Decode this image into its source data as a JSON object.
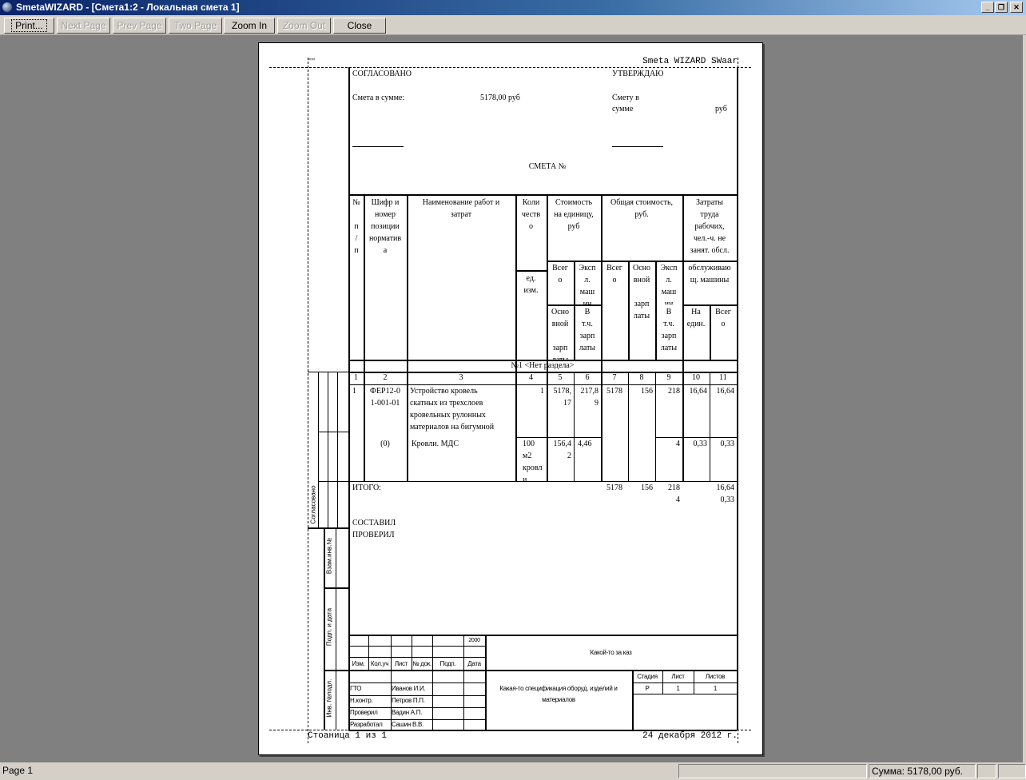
{
  "window": {
    "title": "SmetaWIZARD - [Смета1:2 - Локальная смета 1]",
    "controls": [
      "_",
      "❐",
      "✕"
    ]
  },
  "toolbar": [
    {
      "label": "Print...",
      "enabled": true
    },
    {
      "label": "Next Page",
      "enabled": false
    },
    {
      "label": "Prev Page",
      "enabled": false
    },
    {
      "label": "Two Page",
      "enabled": false
    },
    {
      "label": "Zoom In",
      "enabled": true
    },
    {
      "label": "Zoom Out",
      "enabled": false
    },
    {
      "label": "Close",
      "enabled": true
    }
  ],
  "page": {
    "top_left": "\"\"",
    "top_right": "Smeta WIZARD SWaar",
    "agreed": "СОГЛАСОВАНО",
    "approve": "УТВЕРЖДАЮ",
    "sum_label": "Смета в сумме:",
    "sum_value": "5178,00 руб",
    "approve_sum_1": "Смету в",
    "approve_sum_2": "сумме",
    "approve_sum_cur": "руб",
    "doc_title": "СМЕТА №",
    "headers": {
      "num": "№\n\nп\n/\nп",
      "code": "Шифр и\nномер\nпозиции\nнорматив\nа",
      "name": "Наименование работ и\nзатрат",
      "qty": "Коли\nчеств\nо",
      "unit": "ед.\nизм.",
      "unit_cost": "Стоимость\nна единицу,\nруб",
      "total_cost": "Общая стоимость,\nруб.",
      "labor": "Затраты\nтруда\nрабочих,\nчел.-ч. не\nзанят. обсл.\nмашин",
      "uc_total": "Всег\nо",
      "uc_mach": "Эксп\nл.\nмаш\nин",
      "uc_wage": "Осно\nвной\n\nзарп\nлаты",
      "uc_incl": "В\nт.ч.\nзарп\nлаты",
      "tc_total": "Всег\nо",
      "tc_wage": "Осно\nвной\n\nзарп\nлаты",
      "tc_mach": "Эксп\nл.\nмаш\nин",
      "tc_incl": "В\nт.ч.\nзарп\nлаты",
      "labor_mach": "обслуживаю\nщ. машины",
      "labor_unit": "На\nедин.",
      "labor_total": "Всег\nо"
    },
    "section": "№1 <Нет раздела>",
    "col_numbers": [
      "1",
      "2",
      "3",
      "4",
      "5",
      "6",
      "7",
      "8",
      "9",
      "10",
      "11"
    ],
    "rows": [
      {
        "num": "1",
        "code": "ФЕР12-0\n1-001-01",
        "name": "Устройство кровель\nскатных из трехслоев\nкровельных рулонных\nматериалов на бигумной\nмастике",
        "qty": "1",
        "c5": "5178,\n17",
        "c6": "217,8\n9",
        "c7": "5178",
        "c8": "156",
        "c9": "218",
        "c10": "16,64",
        "c11": "16,64",
        "sub_code": "(0)",
        "sub_name": "Кровли. МДС",
        "unit": "100\nм2\nкровл\nи",
        "s5": "156,4\n2",
        "s6": "4,46",
        "s9": "4",
        "s10": "0,33",
        "s11": "0,33"
      }
    ],
    "total": {
      "label": "ИТОГО:",
      "c7": "5178",
      "c8": "156",
      "c9": "218\n4",
      "c11": "16,64\n0,33"
    },
    "composed": "СОСТАВИЛ",
    "checked": "ПРОВЕРИЛ",
    "side_stamp": {
      "agreed": "Согласовано",
      "replaced": "Взам.инв.№",
      "signdate": "Подп. и дата",
      "inv": "Инв. №подл."
    },
    "stamp": {
      "year": "2000",
      "cols": [
        "Изм.",
        "Кол.уч",
        "Лист",
        "№ док.",
        "Подп.",
        "Дата"
      ],
      "project": "Какой-то за каз",
      "roles": [
        "ГТО",
        "Н.контр.",
        "Проверил",
        "Разработал"
      ],
      "names": [
        "Иванов И.И.",
        "Петров П.П.",
        "Вадин А.П.",
        "Сашин В.В."
      ],
      "spec": "Какая-то спецификация оборуд. изделий и\nматериалов",
      "stage_label": "Стадия",
      "sheet_label": "Лист",
      "sheets_label": "Листов",
      "stage": "Р",
      "sheet": "1",
      "sheets": "1"
    },
    "footer_left": "Стоаница 1 из 1",
    "footer_right": "24 декабря 2012 г."
  },
  "status": {
    "page": "Page 1",
    "sum": "Сумма: 5178,00 руб."
  }
}
